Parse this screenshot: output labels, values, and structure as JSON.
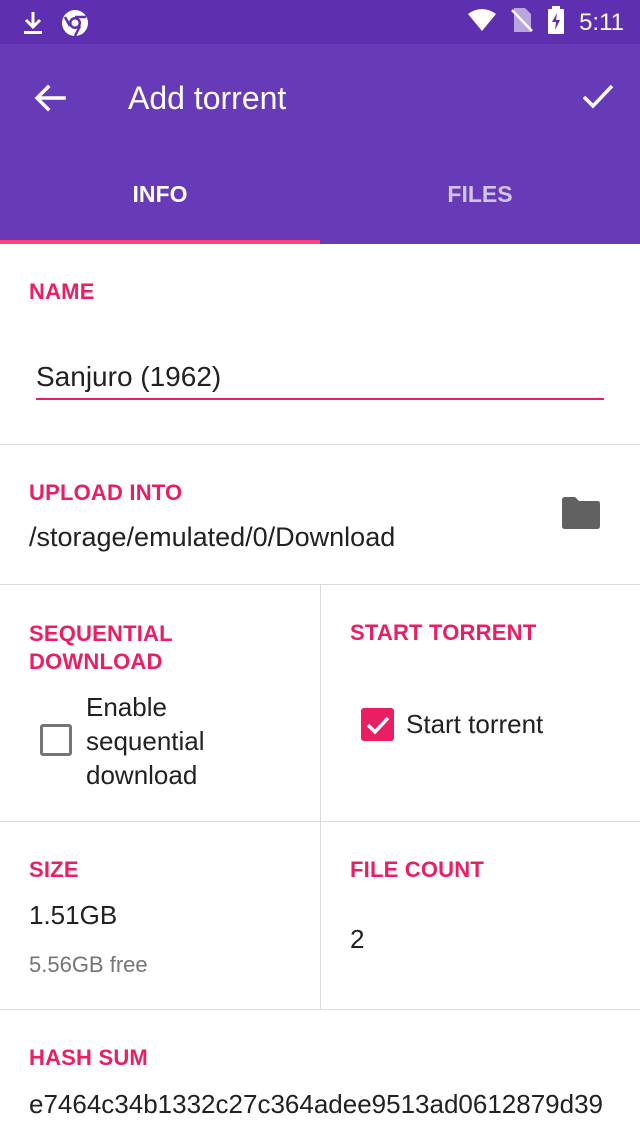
{
  "status_bar": {
    "time": "5:11",
    "icons": [
      "download-icon",
      "chrome-icon",
      "wifi-icon",
      "no-sim-icon",
      "battery-charging-icon"
    ]
  },
  "toolbar": {
    "title": "Add torrent",
    "back_icon": "arrow-back-icon",
    "confirm_icon": "check-icon"
  },
  "tabs": [
    {
      "label": "INFO",
      "active": true
    },
    {
      "label": "FILES",
      "active": false
    }
  ],
  "name": {
    "label": "NAME",
    "value": "Sanjuro (1962)"
  },
  "upload": {
    "label": "UPLOAD INTO",
    "path": "/storage/emulated/0/Download",
    "icon": "folder-icon"
  },
  "sequential": {
    "label": "SEQUENTIAL DOWNLOAD",
    "checkbox_label": "Enable sequential download",
    "checked": false
  },
  "start": {
    "label": "START TORRENT",
    "checkbox_label": "Start torrent",
    "checked": true
  },
  "size": {
    "label": "SIZE",
    "value": "1.51GB",
    "free": "5.56GB free"
  },
  "file_count": {
    "label": "FILE COUNT",
    "value": "2"
  },
  "hash": {
    "label": "HASH SUM",
    "value": "e7464c34b1332c27c364adee9513ad0612879d39"
  },
  "colors": {
    "primary": "#673ab7",
    "primary_dark": "#5e2fae",
    "accent": "#e91e63",
    "tab_indicator": "#ff4081"
  }
}
